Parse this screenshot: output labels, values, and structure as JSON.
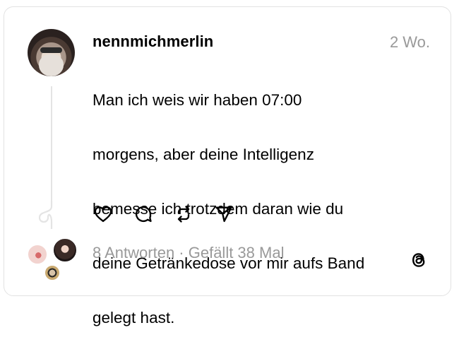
{
  "post": {
    "username": "nennmichmerlin",
    "time": "2 Wo.",
    "text_lines": [
      "Man ich weis wir haben 07:00",
      "morgens, aber deine Intelligenz",
      "bemesse ich trotzdem daran wie du",
      "deine Getränkedose vor mir aufs Band",
      "gelegt hast."
    ]
  },
  "actions": {
    "like_icon": "heart-icon",
    "comment_icon": "comment-icon",
    "repost_icon": "repost-icon",
    "share_icon": "send-icon"
  },
  "footer": {
    "replies_meta": "8 Antworten · Gefällt 38 Mal",
    "logo_icon": "threads-logo-icon"
  }
}
